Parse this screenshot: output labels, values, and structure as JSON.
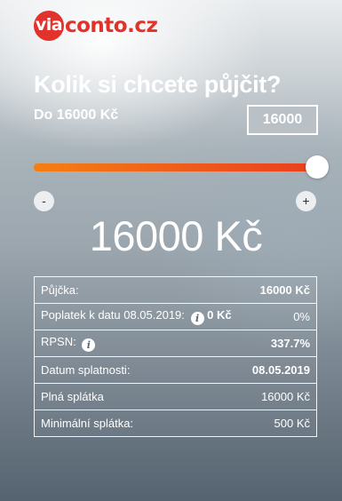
{
  "brand": {
    "badge": "via",
    "word": "conto.cz",
    "color": "#e2322c"
  },
  "header": {
    "title": "Kolik si chcete půjčit?",
    "subtitle": "Do 16000 Kč"
  },
  "amount_input": {
    "value": "16000"
  },
  "slider": {
    "value": 16000,
    "max": 16000,
    "fill_fraction": 1.0,
    "colors": [
      "#f57f12",
      "#ea3e1f"
    ]
  },
  "stepper": {
    "minus": "-",
    "plus": "+"
  },
  "big_amount": "16000 Kč",
  "summary": {
    "rows": [
      {
        "label": "Půjčka:",
        "value": "16000 Kč"
      },
      {
        "label": "Poplatek k datu 08.05.2019:",
        "fee": "0 Kč",
        "value": "0%"
      },
      {
        "label": "RPSN:",
        "value": "337.7%"
      },
      {
        "label": "Datum splatnosti:",
        "value": "08.05.2019"
      },
      {
        "label": "Plná splátka",
        "value": "16000 Kč"
      },
      {
        "label": "Minimální splátka:",
        "value": "500 Kč"
      }
    ],
    "info_icon": "i"
  }
}
